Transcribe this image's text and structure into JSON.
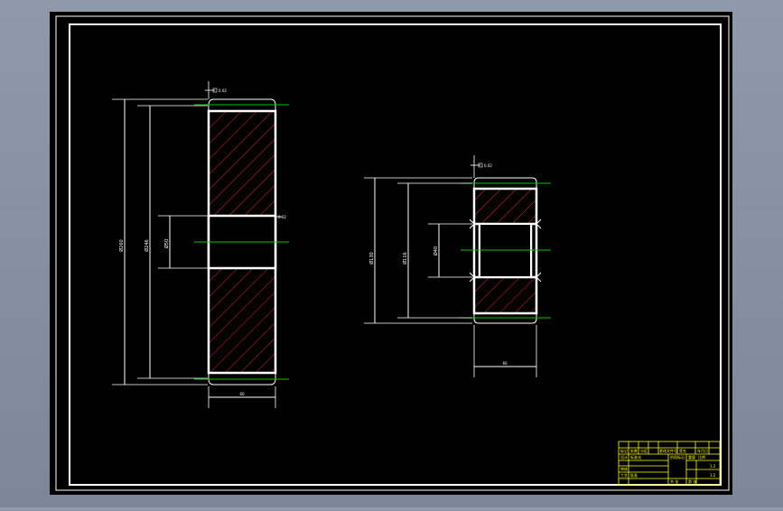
{
  "drawing": {
    "background_color": "#8e9aab",
    "paper_color": "#000000",
    "frame_color": "#ffffff",
    "hatch_color": "#e8281e",
    "centerline_color": "#00c800",
    "title_block_color": "#ffff00"
  },
  "left_gear": {
    "dims": {
      "top_tolerance": "0.02",
      "outer_diameter": "Ø260",
      "root_diameter": "Ø246",
      "bore_diameter": "Ø50",
      "bore_tolerance": "0.02",
      "face_width": "60"
    }
  },
  "right_gear": {
    "dims": {
      "top_tolerance": "0.02",
      "outer_diameter": "Ø130",
      "root_diameter": "Ø116",
      "bore_diameter": "Ø40",
      "face_width": "60"
    }
  },
  "title_block": {
    "r1": [
      "标记",
      "处数",
      "分区",
      "更改文件号",
      "签名",
      "年月日"
    ],
    "design": "设计",
    "standardize": "标准化",
    "review": "审核",
    "process": "工艺",
    "approve": "批准",
    "stage": "阶段标记",
    "weight": "重量",
    "scale": "比例",
    "sheets": "共 张",
    "sheet": "第 张",
    "ratio": "1:2"
  }
}
